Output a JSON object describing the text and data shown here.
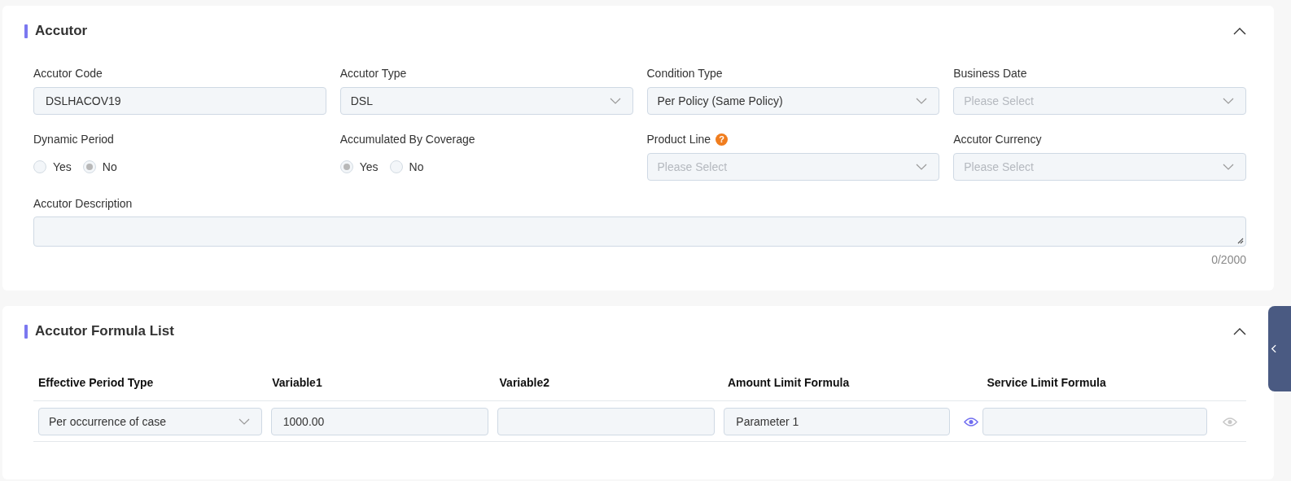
{
  "accutor": {
    "title": "Accutor",
    "expanded": true,
    "fields": [
      {
        "kind": "input",
        "label": "Accutor Code",
        "value": "DSLHACOV19"
      },
      {
        "kind": "select",
        "label": "Accutor Type",
        "value": "DSL"
      },
      {
        "kind": "select",
        "label": "Condition Type",
        "value": "Per Policy (Same Policy)"
      },
      {
        "kind": "select",
        "label": "Business Date",
        "placeholder": "Please Select"
      },
      {
        "kind": "radio",
        "label": "Dynamic Period",
        "options": [
          {
            "label": "Yes",
            "selected": false
          },
          {
            "label": "No",
            "selected": true
          }
        ]
      },
      {
        "kind": "radio",
        "label": "Accumulated By Coverage",
        "options": [
          {
            "label": "Yes",
            "selected": true
          },
          {
            "label": "No",
            "selected": false
          }
        ]
      },
      {
        "kind": "select",
        "label": "Product Line",
        "help": "?",
        "placeholder": "Please Select"
      },
      {
        "kind": "select",
        "label": "Accutor Currency",
        "placeholder": "Please Select"
      }
    ],
    "description": {
      "label": "Accutor Description",
      "counter": "0/2000"
    }
  },
  "formula_list": {
    "title": "Accutor Formula List",
    "expanded": true,
    "columns": [
      "Effective Period Type",
      "Variable1",
      "Variable2",
      "Amount Limit Formula",
      "Service Limit Formula"
    ],
    "rows": [
      {
        "cells": [
          {
            "kind": "select",
            "value": "Per occurrence of case"
          },
          {
            "kind": "input",
            "value": "1000.00"
          },
          {
            "kind": "input"
          },
          {
            "kind": "formula",
            "value": "Parameter 1",
            "preview_enabled": true
          },
          {
            "kind": "formula",
            "preview_enabled": false
          }
        ]
      }
    ]
  }
}
